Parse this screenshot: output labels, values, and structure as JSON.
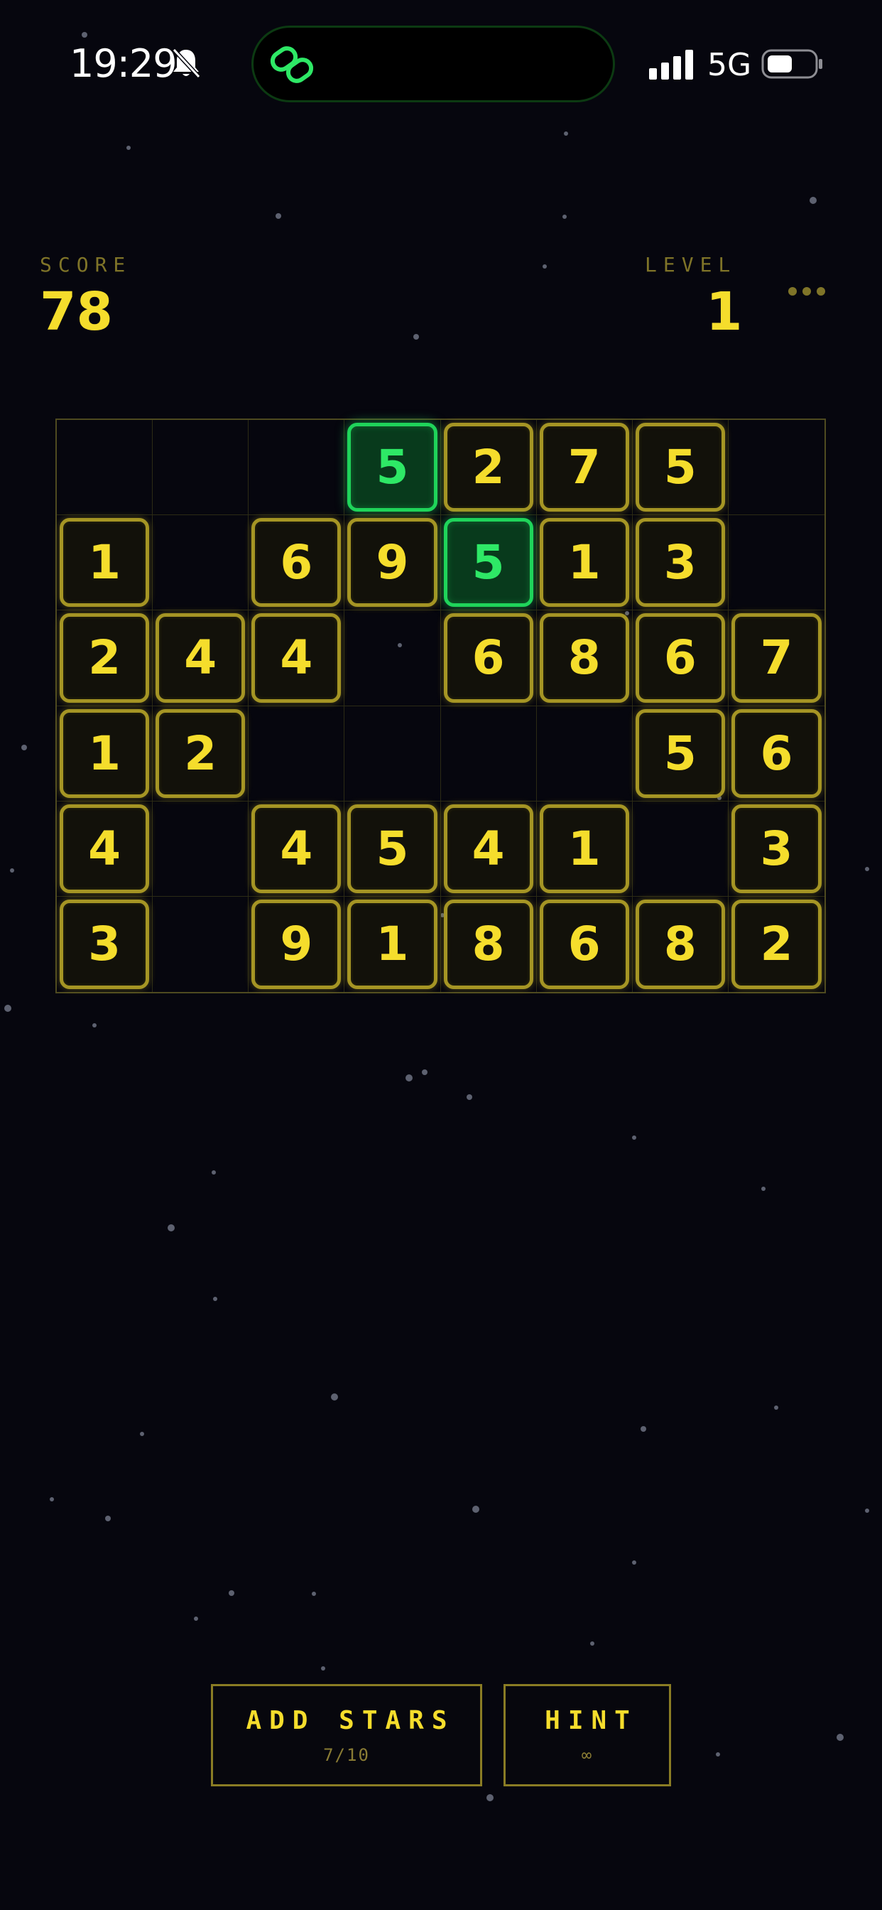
{
  "status_bar": {
    "time": "19:29",
    "network": "5G",
    "icons": [
      "bell-slash-icon",
      "link-icon",
      "signal-icon",
      "battery-icon"
    ]
  },
  "header": {
    "score_label": "SCORE",
    "score_value": "78",
    "level_label": "LEVEL",
    "level_value": "1"
  },
  "board": {
    "columns": 8,
    "rows": [
      [
        "",
        "",
        "",
        "5",
        "2",
        "7",
        "5",
        ""
      ],
      [
        "1",
        "",
        "6",
        "9",
        "5",
        "1",
        "3",
        ""
      ],
      [
        "2",
        "4",
        "4",
        "",
        "6",
        "8",
        "6",
        "7"
      ],
      [
        "1",
        "2",
        "",
        "",
        "",
        "",
        "5",
        "6"
      ],
      [
        "4",
        "",
        "4",
        "5",
        "4",
        "1",
        "",
        "3"
      ],
      [
        "3",
        "",
        "9",
        "1",
        "8",
        "6",
        "8",
        "2"
      ]
    ],
    "selected": [
      [
        0,
        3
      ],
      [
        1,
        4
      ]
    ]
  },
  "buttons": {
    "add_stars_label": "ADD STARS",
    "add_stars_count": "7/10",
    "hint_label": "HINT",
    "hint_count": "∞"
  },
  "colors": {
    "background": "#06060e",
    "accent_yellow": "#f5dd2c",
    "accent_green": "#2ee866",
    "muted_gold": "#7f7428"
  }
}
